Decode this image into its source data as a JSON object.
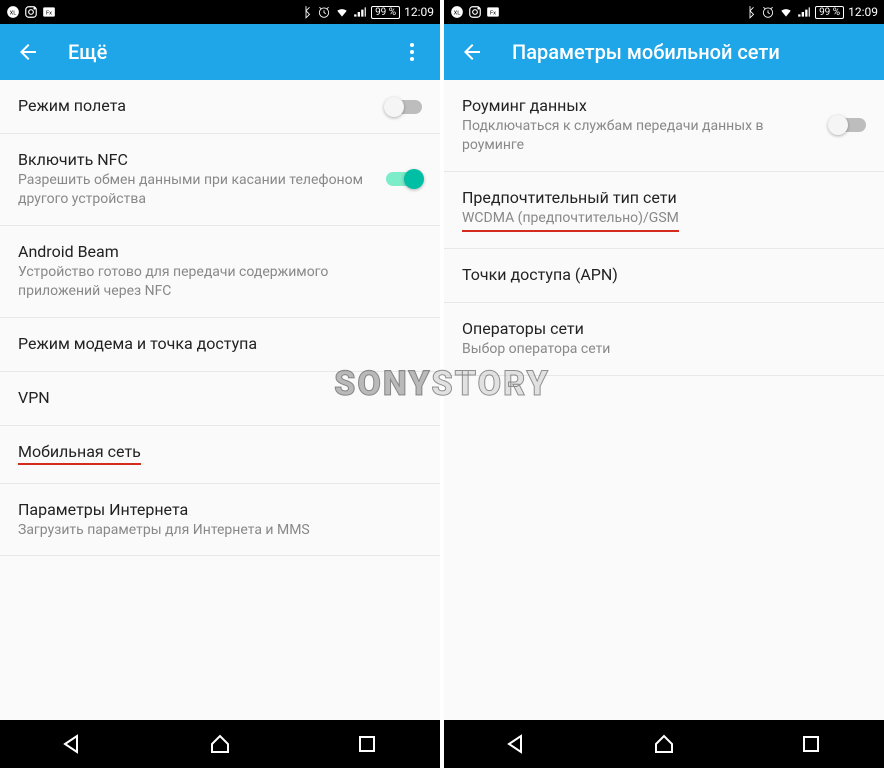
{
  "status": {
    "battery": "99 %",
    "time": "12:09"
  },
  "watermark": {
    "part1": "SONY",
    "part2": "STORY"
  },
  "left": {
    "title": "Ещё",
    "items": [
      {
        "title": "Режим полета",
        "sub": "",
        "toggle": "off"
      },
      {
        "title": "Включить NFC",
        "sub": "Разрешить обмен данными при касании телефоном другого устройства",
        "toggle": "on"
      },
      {
        "title": "Android Beam",
        "sub": "Устройство готово для передачи содержимого приложений через NFC"
      },
      {
        "title": "Режим модема и точка доступа",
        "sub": ""
      },
      {
        "title": "VPN",
        "sub": ""
      },
      {
        "title": "Мобильная сеть",
        "sub": "",
        "underline": true
      },
      {
        "title": "Параметры Интернета",
        "sub": "Загрузить параметры для Интернета и MMS"
      }
    ]
  },
  "right": {
    "title": "Параметры мобильной сети",
    "items": [
      {
        "title": "Роуминг данных",
        "sub": "Подключаться к службам передачи данных в роуминге",
        "toggle": "off"
      },
      {
        "title": "Предпочтительный тип сети",
        "sub": "WCDMA (предпочтительно)/GSM",
        "underline_sub": true
      },
      {
        "title": "Точки доступа (APN)",
        "sub": ""
      },
      {
        "title": "Операторы сети",
        "sub": "Выбор оператора сети"
      }
    ]
  }
}
